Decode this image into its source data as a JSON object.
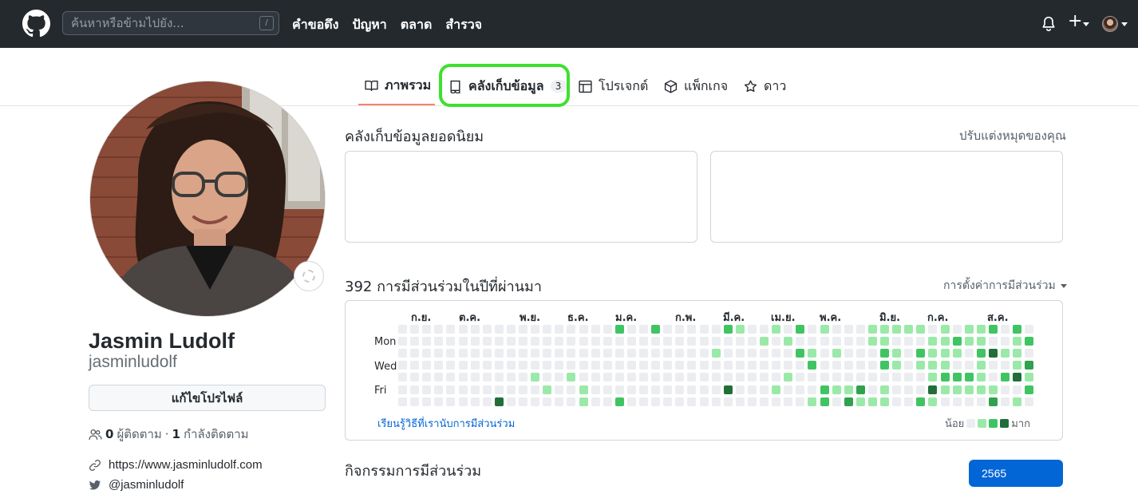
{
  "header": {
    "search_placeholder": "ค้นหาหรือข้ามไปยัง...",
    "search_shortcut": "/",
    "nav": [
      "คำขอดึง",
      "ปัญหา",
      "ตลาด",
      "สำรวจ"
    ],
    "plus": "+"
  },
  "tabs": [
    {
      "label": "ภาพรวม",
      "icon": "book-icon",
      "active": true
    },
    {
      "label": "คลังเก็บข้อมูล",
      "icon": "repo-icon",
      "count": "3"
    },
    {
      "label": "โปรเจกต์",
      "icon": "table-icon"
    },
    {
      "label": "แพ็กเกจ",
      "icon": "package-icon"
    },
    {
      "label": "ดาว",
      "icon": "star-icon"
    }
  ],
  "profile": {
    "name": "Jasmin Ludolf",
    "login": "jasminludolf",
    "edit_button": "แก้ไขโปรไฟล์",
    "followers_count": "0",
    "followers_label": "ผู้ติดตาม",
    "separator": "·",
    "following_count": "1",
    "following_label": "กำลังติดตาม",
    "website": "https://www.jasminludolf.com",
    "twitter": "@jasminludolf"
  },
  "popular": {
    "title": "คลังเก็บข้อมูลยอดนิยม",
    "customize": "ปรับแต่งหมุดของคุณ"
  },
  "contributions": {
    "title": "392 การมีส่วนร่วมในปีที่ผ่านมา",
    "settings": "การตั้งค่าการมีส่วนร่วม",
    "months": [
      "ก.ย.",
      "ต.ค.",
      "พ.ย.",
      "ธ.ค.",
      "ม.ค.",
      "ก.พ.",
      "มี.ค.",
      "เม.ย.",
      "พ.ค.",
      "มิ.ย.",
      "ก.ค.",
      "ส.ค."
    ],
    "days": [
      "Mon",
      "Wed",
      "Fri"
    ],
    "learn": "เรียนรู้วิธีที่เรานับการมีส่วนร่วม",
    "legend_less": "น้อย",
    "legend_more": "มาก",
    "colors": [
      "#ebedf0",
      "#9be9a8",
      "#40c463",
      "#30a14e",
      "#216e39"
    ]
  },
  "activity": {
    "title": "กิจกรรมการมีส่วนร่วม",
    "year": "2565"
  }
}
